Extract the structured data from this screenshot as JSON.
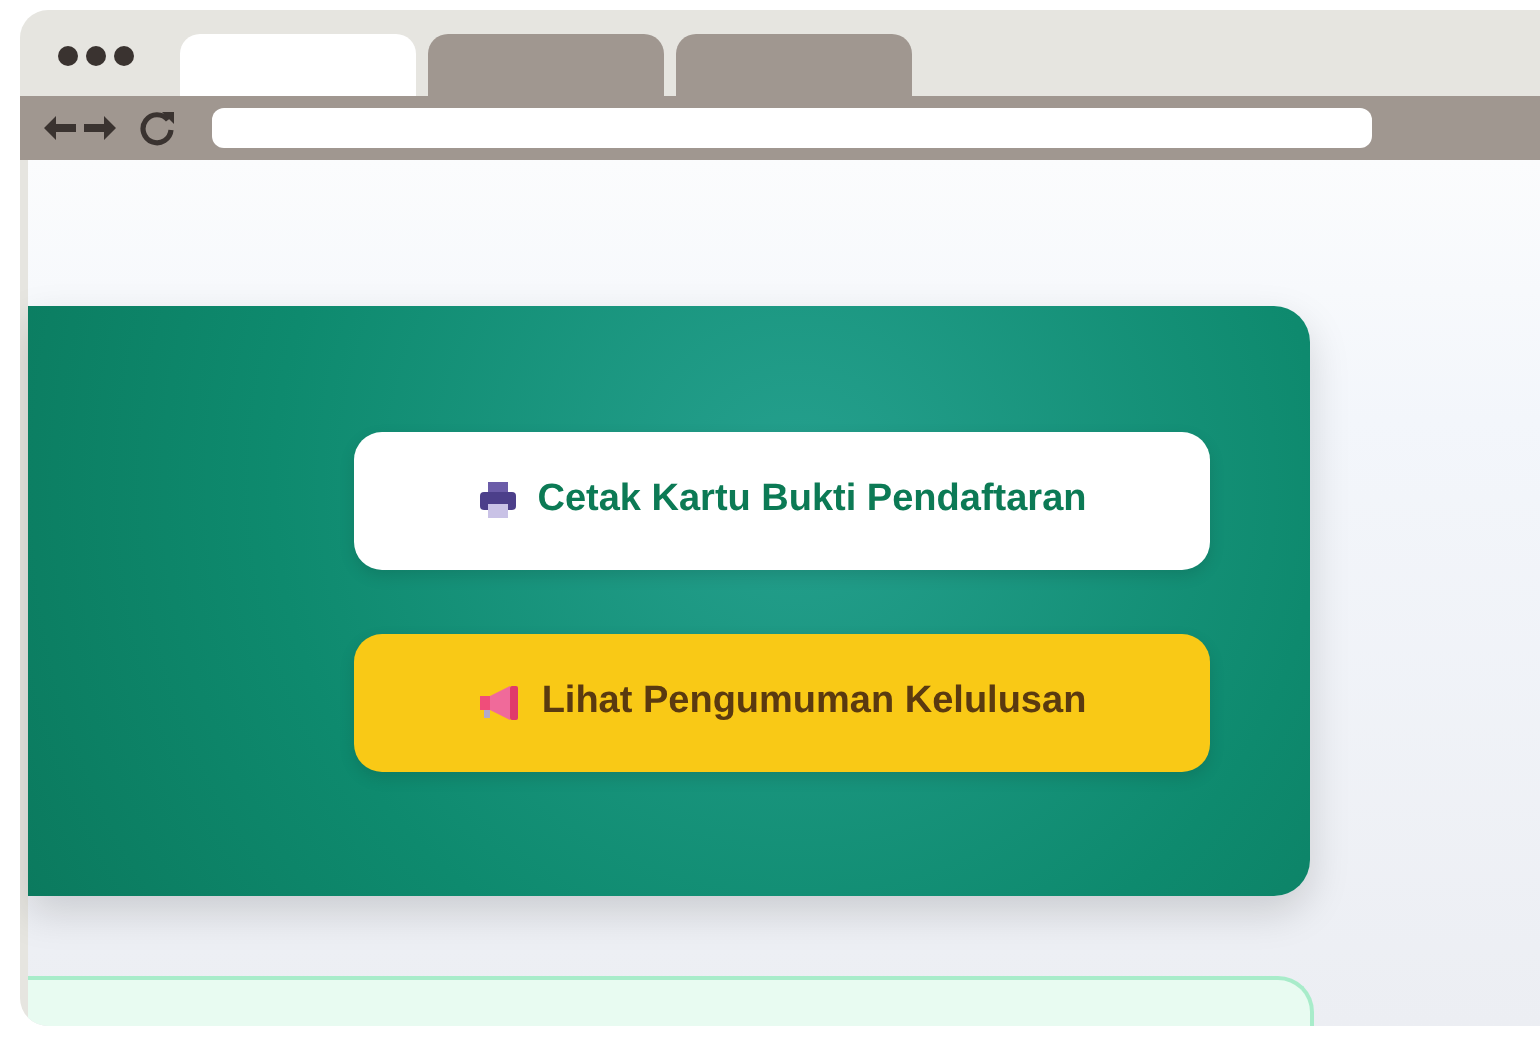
{
  "browser": {
    "tabs": [
      {
        "selected": true
      },
      {
        "selected": false
      },
      {
        "selected": false
      }
    ]
  },
  "buttons": [
    {
      "kind": "print",
      "label": "Cetak Kartu Bukti Pendaftaran"
    },
    {
      "kind": "announce",
      "label": "Lihat Pengumuman Kelulusan"
    }
  ]
}
